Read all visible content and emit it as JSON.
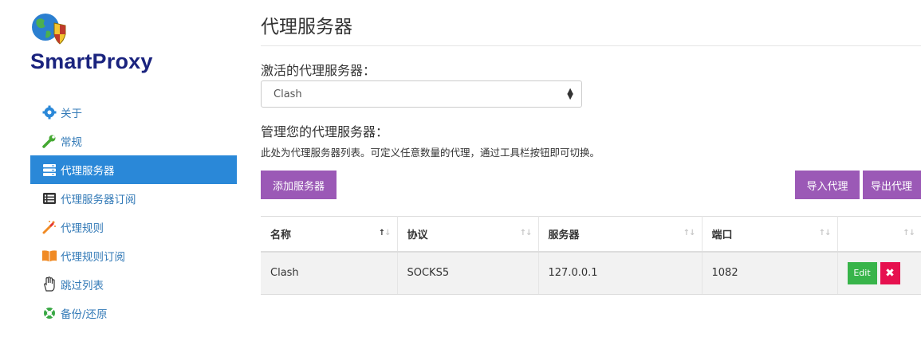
{
  "app": {
    "brand": "SmartProxy"
  },
  "sidebar": {
    "items": [
      {
        "label": "关于",
        "icon": "gear-icon"
      },
      {
        "label": "常规",
        "icon": "wrench-icon"
      },
      {
        "label": "代理服务器",
        "icon": "server-icon",
        "active": true
      },
      {
        "label": "代理服务器订阅",
        "icon": "list-icon"
      },
      {
        "label": "代理规则",
        "icon": "magic-wand-icon"
      },
      {
        "label": "代理规则订阅",
        "icon": "book-icon"
      },
      {
        "label": "跳过列表",
        "icon": "hand-icon"
      },
      {
        "label": "备份/还原",
        "icon": "lifebuoy-icon"
      }
    ]
  },
  "main": {
    "title": "代理服务器",
    "active_label": "激活的代理服务器：",
    "active_select": "Clash",
    "manage_label": "管理您的代理服务器：",
    "description": "此处为代理服务器列表。可定义任意数量的代理，通过工具栏按钮即可切换。",
    "add_button": "添加服务器",
    "import_button": "导入代理",
    "export_button": "导出代理"
  },
  "table": {
    "columns": [
      "名称",
      "协议",
      "服务器",
      "端口",
      ""
    ],
    "rows": [
      {
        "name": "Clash",
        "protocol": "SOCKS5",
        "server": "127.0.0.1",
        "port": "1082"
      }
    ],
    "edit_label": "Edit",
    "delete_label": "✖"
  },
  "colors": {
    "accent": "#2a88d8",
    "button_purple": "#9b59b6",
    "edit_green": "#38b44a",
    "delete_red": "#e6114f",
    "brand": "#1a237e"
  }
}
